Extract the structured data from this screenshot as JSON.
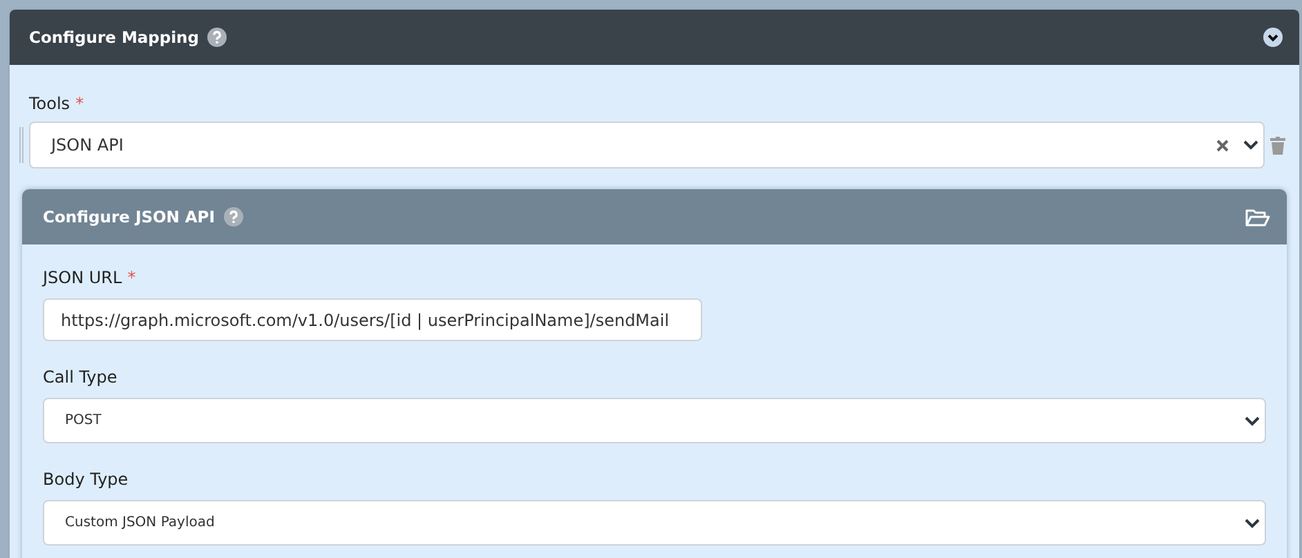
{
  "mapping_panel": {
    "title": "Configure Mapping",
    "tools": {
      "label": "Tools",
      "required_mark": "*",
      "value": "JSON API"
    },
    "json_api_panel": {
      "title": "Configure JSON API",
      "fields": [
        {
          "kind": "text",
          "label": "JSON URL",
          "required_mark": "*",
          "value": "https://graph.microsoft.com/v1.0/users/[id | userPrincipalName]/sendMail"
        },
        {
          "kind": "select",
          "label": "Call Type",
          "value": "POST"
        },
        {
          "kind": "select",
          "label": "Body Type",
          "value": "Custom JSON Payload"
        }
      ]
    }
  }
}
